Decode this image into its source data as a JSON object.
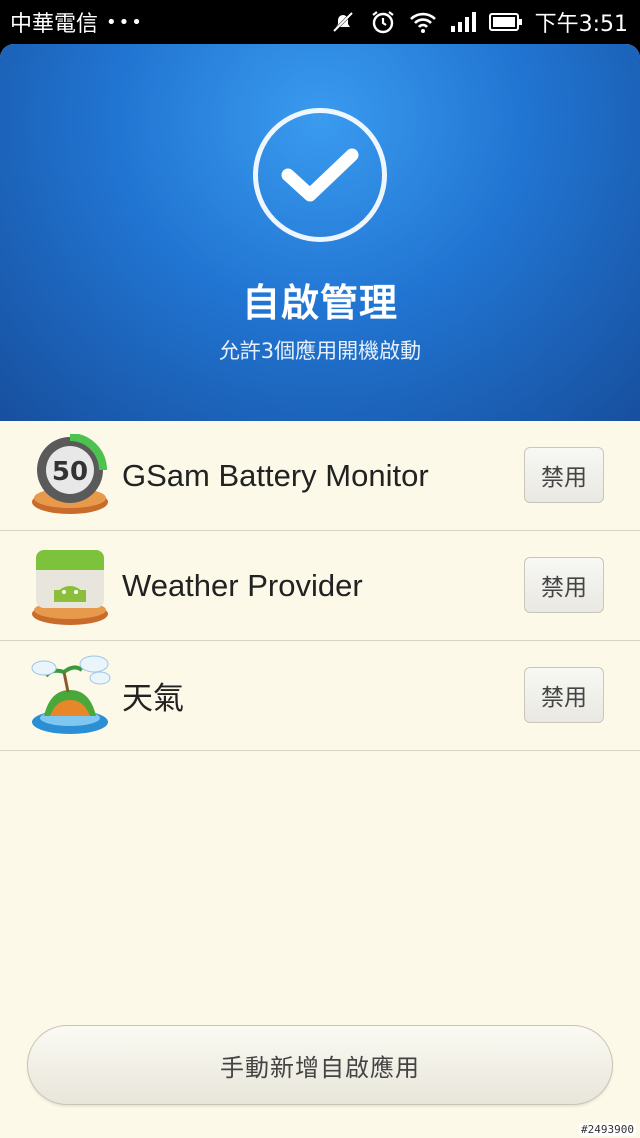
{
  "status_bar": {
    "carrier": "中華電信",
    "dots": "•••",
    "time": "下午3:51",
    "icons": [
      "muted-icon",
      "alarm-icon",
      "wifi-icon",
      "signal-icon",
      "battery-icon"
    ]
  },
  "hero": {
    "icon": "checkmark-icon",
    "title": "自啟管理",
    "subtitle": "允許3個應用開機啟動",
    "colors": {
      "top": "#3a9bef",
      "bottom": "#174f9e"
    }
  },
  "apps": [
    {
      "name": "GSam Battery Monitor",
      "icon": "gsam-battery-icon",
      "badge": "50",
      "button": "禁用"
    },
    {
      "name": "Weather Provider",
      "icon": "weather-provider-icon",
      "button": "禁用"
    },
    {
      "name": "天氣",
      "icon": "weather-island-icon",
      "button": "禁用"
    }
  ],
  "bottom_button": {
    "label": "手動新增自啟應用"
  },
  "watermark": "#2493900"
}
